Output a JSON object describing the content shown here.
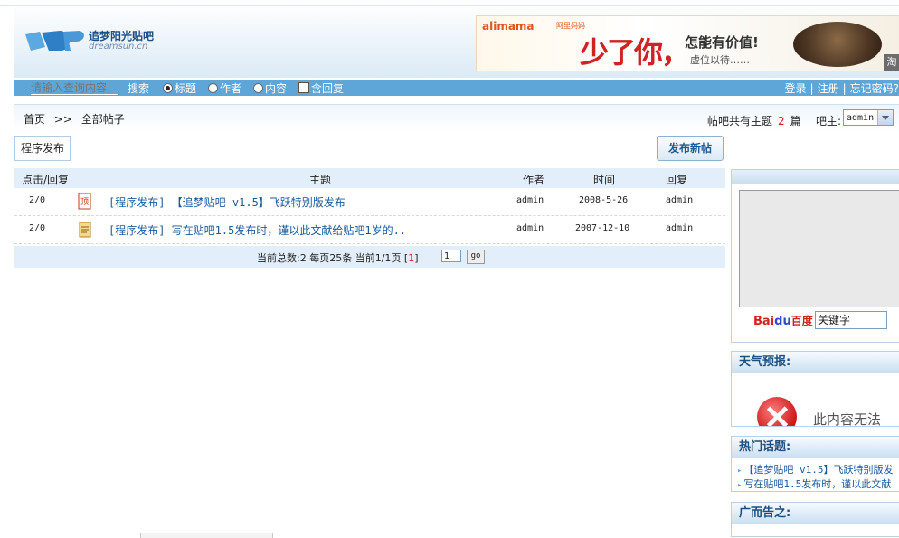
{
  "logo": {
    "title": "追梦阳光贴吧",
    "subtitle": "dreamsun.cn"
  },
  "banner": {
    "brand": "alimama",
    "brand_suffix": "阿里妈妈",
    "headline": "少了你，",
    "tagline": "怎能有价值!",
    "sub": "虚位以待……",
    "corner": "淘"
  },
  "nav": {
    "search_placeholder": "请输入查询内容",
    "search_label": "搜索",
    "options": [
      "标题",
      "作者",
      "内容"
    ],
    "include_reply": "含回复",
    "login": "登录",
    "register": "注册",
    "forgot": "忘记密码?"
  },
  "breadcrumb": {
    "home": "首页",
    "sep": ">>",
    "current": "全部帖子"
  },
  "stats": {
    "prefix": "帖吧共有主题",
    "count": "2",
    "suffix": "篇",
    "owner_label": "吧主:",
    "owner": "admin"
  },
  "buttons": {
    "program": "程序发布",
    "new_post": "发布新帖"
  },
  "table": {
    "headers": [
      "点击/回复",
      "主题",
      "作者",
      "时间",
      "回复"
    ],
    "rows": [
      {
        "clicks": "2/0",
        "title": "[程序发布] 【追梦贴吧 v1.5】飞跃特别版发布",
        "author": "admin",
        "time": "2008-5-26",
        "reply": "admin"
      },
      {
        "clicks": "2/0",
        "title": "[程序发布] 写在贴吧1.5发布时，谨以此文献给贴吧1岁的..",
        "author": "admin",
        "time": "2007-12-10",
        "reply": "admin"
      }
    ]
  },
  "pager": {
    "text": "当前总数:2 每页25条 当前1/1页 [",
    "page": "1",
    "close": "]",
    "input": "1",
    "go": "go"
  },
  "sidebar": {
    "baidu": {
      "b1": "Bai",
      "paw": "du",
      "b2": "百度"
    },
    "keyword": "关键字",
    "weather_title": "天气预报:",
    "weather_msg": "此内容无法",
    "hot_title": "热门话题:",
    "hot_items": [
      "【追梦贴吧 v1.5】飞跃特别版发",
      "写在贴吧1.5发布时，谨以此文献"
    ],
    "ad_title": "广而告之:"
  },
  "colors": {
    "nav_bg": "#5fa6d8",
    "accent_red": "#d61b1b",
    "link": "#1b5a9a"
  }
}
